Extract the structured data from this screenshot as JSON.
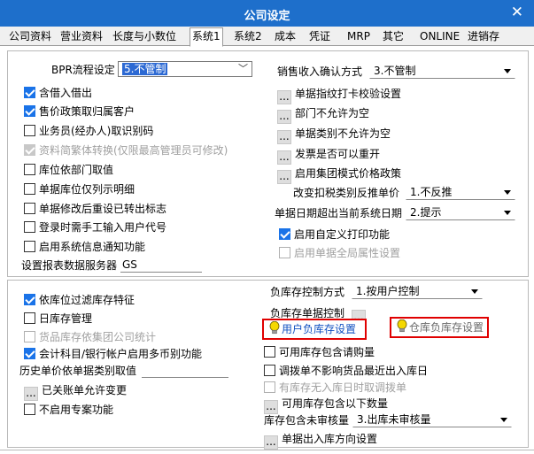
{
  "window": {
    "title": "公司设定",
    "close_glyph": "✕"
  },
  "tabs": [
    "公司资料",
    "营业资料",
    "长度与小数位",
    "系统1",
    "系统2",
    "成本",
    "凭证",
    "MRP",
    "其它",
    "ONLINE",
    "进销存"
  ],
  "top_left": {
    "bpr_label": "BPR流程设定",
    "bpr_value": "5.不管制",
    "checkboxes": [
      {
        "label": "含借入借出",
        "checked": true,
        "disabled": false
      },
      {
        "label": "售价政策取归属客户",
        "checked": true,
        "disabled": false
      },
      {
        "label": "业务员(经办人)取识别码",
        "checked": false,
        "disabled": false
      },
      {
        "label": "资料简繁体转换(仅限最高管理员可修改)",
        "checked": true,
        "disabled": true
      },
      {
        "label": "库位依部门取值",
        "checked": false,
        "disabled": false
      },
      {
        "label": "单据库位仅列示明细",
        "checked": false,
        "disabled": false
      },
      {
        "label": "单据修改后重设已转出标志",
        "checked": false,
        "disabled": false
      },
      {
        "label": "登录时需手工输入用户代号",
        "checked": false,
        "disabled": false
      },
      {
        "label": "启用系统信息通知功能",
        "checked": false,
        "disabled": false
      }
    ],
    "server_label": "设置报表数据服务器",
    "server_value": "GS"
  },
  "top_right": {
    "sales_confirm_label": "销售收入确认方式",
    "sales_confirm_value": "3.不管制",
    "buttons": [
      {
        "label": "单据指纹打卡校验设置"
      },
      {
        "label": "部门不允许为空"
      },
      {
        "label": "单据类别不允许为空"
      },
      {
        "label": "发票是否可以重开"
      },
      {
        "label": "启用集团模式价格政策"
      }
    ],
    "tax_label": "改变扣税类别反推单价",
    "tax_value": "1.不反推",
    "date_label": "单据日期超出当前系统日期",
    "date_value": "2.提示",
    "custom_print": {
      "label": "启用自定义打印功能",
      "checked": true
    },
    "global_attr": {
      "label": "启用单据全局属性设置",
      "checked": false
    }
  },
  "bottom_left": {
    "checkboxes": [
      {
        "label": "依库位过滤库存特征",
        "checked": true,
        "disabled": false
      },
      {
        "label": "日库存管理",
        "checked": false,
        "disabled": false
      },
      {
        "label": "货品库存依集团公司统计",
        "checked": false,
        "disabled": true
      },
      {
        "label": "会计科目/银行帐户启用多币别功能",
        "checked": true,
        "disabled": false
      }
    ],
    "history_label": "历史单价依单据类别取值",
    "linked_change_label": "已关账单允许变更",
    "no_project_label": "不启用专案功能"
  },
  "bottom_right": {
    "neg_stock_label": "负库存控制方式",
    "neg_stock_value": "1.按用户控制",
    "neg_doc_label": "负库存单据控制",
    "user_neg_label": "用户负库存设置",
    "wh_neg_label": "仓库负库存设置",
    "checkboxes": [
      {
        "label": "可用库存包含请购量",
        "checked": false,
        "disabled": false
      },
      {
        "label": "调拨单不影响货品最近出入库日",
        "checked": false,
        "disabled": false
      },
      {
        "label": "有库存无入库日时取调拨单",
        "checked": false,
        "disabled": true
      }
    ],
    "below_label": "可用库存包含以下数量",
    "unapproved_label": "库存包含未审核量",
    "unapproved_value": "3.出库未审核量",
    "direction_label": "单据出入库方向设置"
  },
  "icons": {
    "bulb_color": "#f5d800",
    "accent": "#1e6fcb",
    "check_color": "#1a73e8",
    "highlight_border": "#e00000"
  }
}
